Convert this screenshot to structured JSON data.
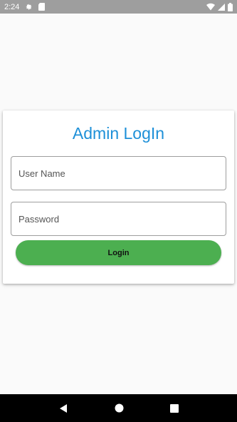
{
  "status_bar": {
    "time": "2:24",
    "icons": [
      "gear-icon",
      "sd-card-icon",
      "wifi-icon",
      "signal-icon",
      "battery-icon"
    ]
  },
  "login_card": {
    "title": "Admin LogIn",
    "username_placeholder": "User Name",
    "password_placeholder": "Password",
    "login_label": "Login"
  },
  "colors": {
    "title": "#1e90d8",
    "login_button": "#4caf50",
    "status_bar": "#9e9e9e",
    "nav_bar": "#000000"
  },
  "nav_bar": {
    "icons": [
      "back-icon",
      "home-icon",
      "recents-icon"
    ]
  }
}
